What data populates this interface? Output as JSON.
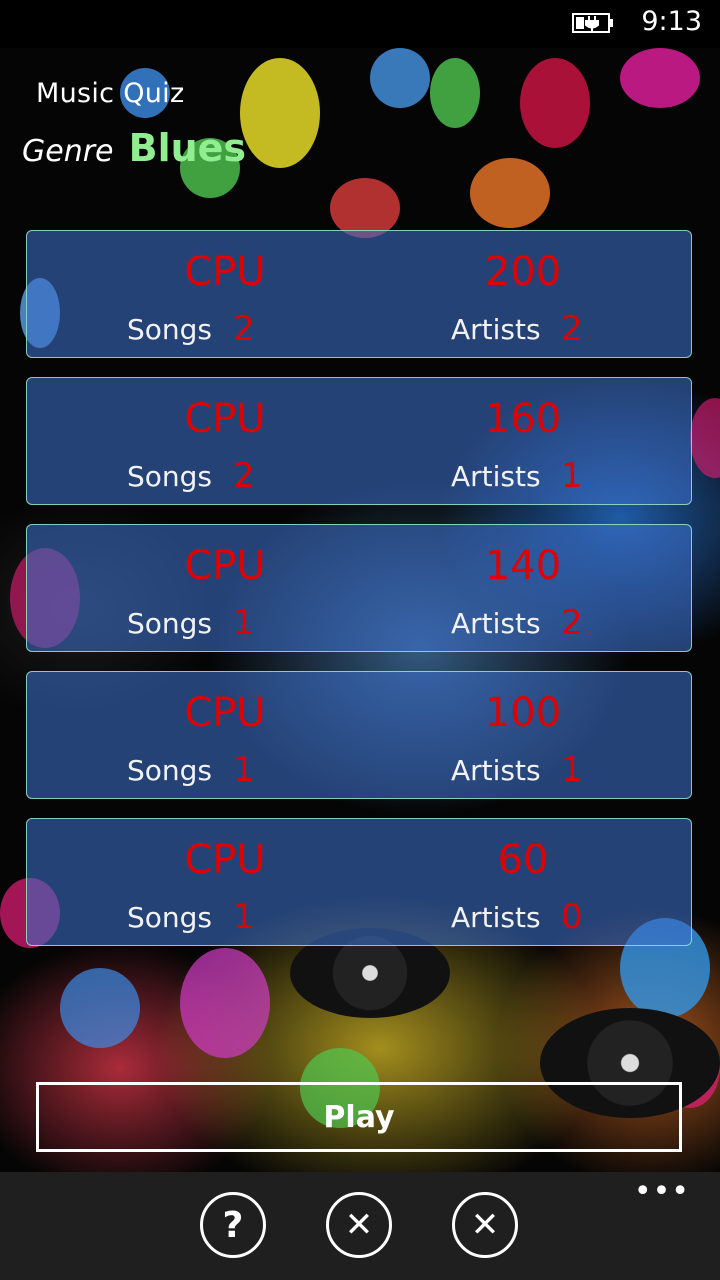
{
  "status_bar": {
    "time": "9:13",
    "battery_icon": "battery-charging-icon"
  },
  "header": {
    "app_title": "Music Quiz",
    "genre_label": "Genre",
    "genre_value": "Blues"
  },
  "rounds": [
    {
      "cpu_label": "CPU",
      "cpu_score": "200",
      "songs_label": "Songs",
      "songs_value": "2",
      "artists_label": "Artists",
      "artists_value": "2"
    },
    {
      "cpu_label": "CPU",
      "cpu_score": "160",
      "songs_label": "Songs",
      "songs_value": "2",
      "artists_label": "Artists",
      "artists_value": "1"
    },
    {
      "cpu_label": "CPU",
      "cpu_score": "140",
      "songs_label": "Songs",
      "songs_value": "1",
      "artists_label": "Artists",
      "artists_value": "2"
    },
    {
      "cpu_label": "CPU",
      "cpu_score": "100",
      "songs_label": "Songs",
      "songs_value": "1",
      "artists_label": "Artists",
      "artists_value": "1"
    },
    {
      "cpu_label": "CPU",
      "cpu_score": "60",
      "songs_label": "Songs",
      "songs_value": "1",
      "artists_label": "Artists",
      "artists_value": "0"
    }
  ],
  "play_button": {
    "label": "Play"
  },
  "app_bar": {
    "help_icon": "question-icon",
    "help_glyph": "?",
    "close_icon": "close-icon",
    "close_glyph": "✕",
    "more_icon": "more-icon",
    "more_glyph": "•••"
  },
  "colors": {
    "score_red": "#e00000",
    "genre_green": "#90EE90",
    "card_fill": "rgba(60,110,200,0.58)",
    "app_bar": "#1f1f1f"
  }
}
